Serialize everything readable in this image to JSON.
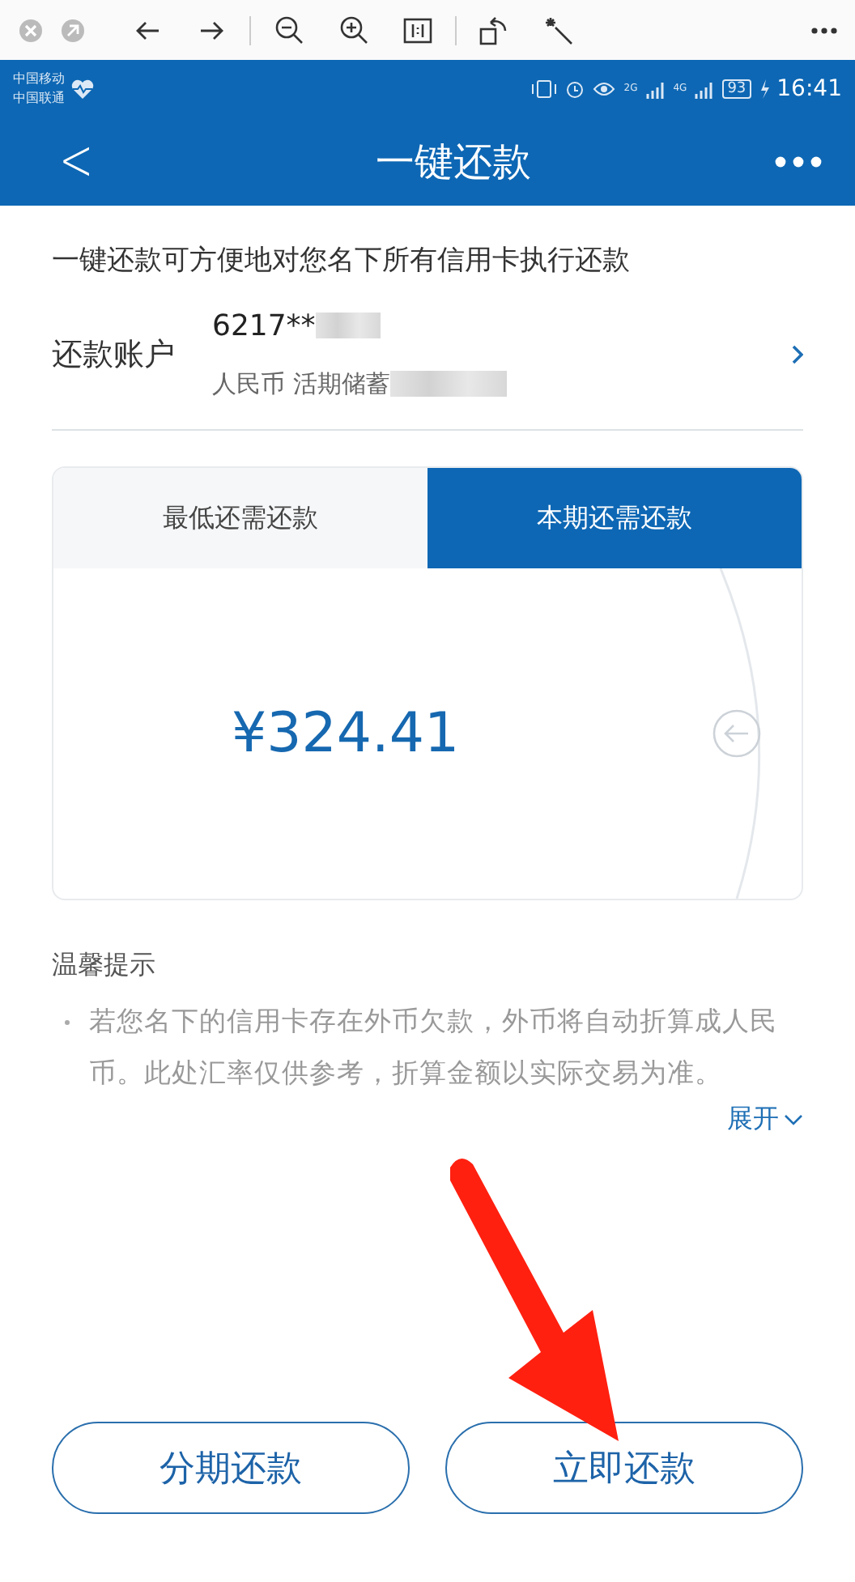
{
  "status_bar": {
    "carriers": [
      "中国移动",
      "中国联通"
    ],
    "network_2g": "2G",
    "network_4g": "4G",
    "battery": "93",
    "time": "16:41"
  },
  "nav_bar": {
    "back": "<",
    "title": "一键还款"
  },
  "intro": "一键还款可方便地对您名下所有信用卡执行还款",
  "account": {
    "label": "还款账户",
    "number": "6217**",
    "type": "人民币 活期储蓄"
  },
  "tabs": [
    {
      "label": "最低还需还款",
      "selected": false
    },
    {
      "label": "本期还需还款",
      "selected": true
    }
  ],
  "amount": "¥324.41",
  "tips": {
    "title": "温馨提示",
    "bullets": [
      "若您名下的信用卡存在外币欠款，外币将自动折算成人民币。此处汇率仅供参考，折算金额以实际交易为准。"
    ],
    "expand": "展开"
  },
  "buttons": [
    "分期还款",
    "立即还款"
  ]
}
